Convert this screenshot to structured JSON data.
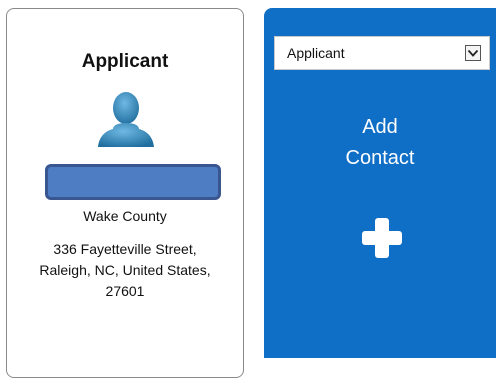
{
  "applicant_card": {
    "title": "Applicant",
    "county": "Wake County",
    "address_line1": "336 Fayetteville Street,",
    "address_line2": "Raleigh, NC, United States,",
    "address_line3": "27601"
  },
  "add_contact_panel": {
    "role_select": {
      "selected": "Applicant"
    },
    "label_line1": "Add",
    "label_line2": "Contact"
  },
  "colors": {
    "panel_blue": "#0f6ec6",
    "name_bar_fill": "#4f7dc3",
    "avatar": "#2f86b6"
  },
  "icons": [
    "person-avatar-icon",
    "chevron-down-icon",
    "plus-icon"
  ]
}
